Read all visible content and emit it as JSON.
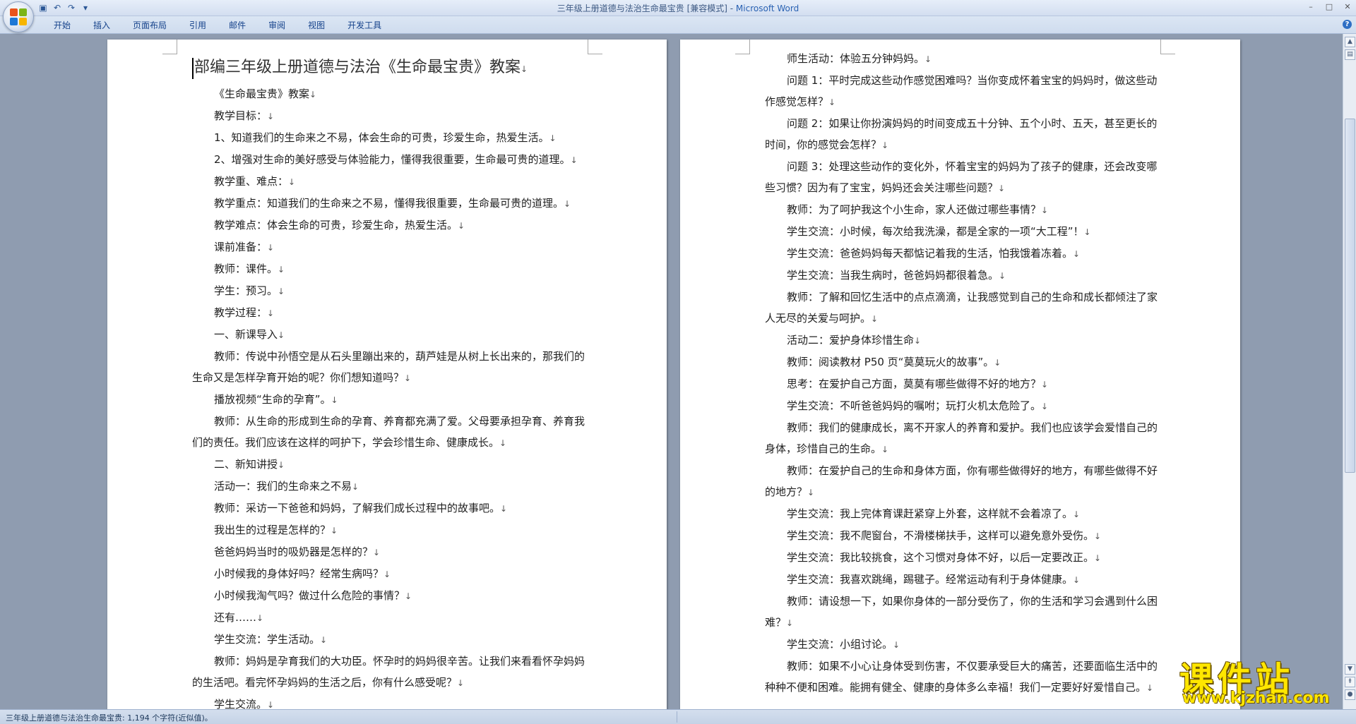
{
  "window": {
    "title": "三年级上册道德与法治生命最宝贵 [兼容模式] - ",
    "app_name": "Microsoft Word",
    "controls": [
      "–",
      "□",
      "✕"
    ]
  },
  "ribbon": {
    "tabs": [
      "开始",
      "插入",
      "页面布局",
      "引用",
      "邮件",
      "审阅",
      "视图",
      "开发工具"
    ]
  },
  "left_page": {
    "title": "部编三年级上册道德与法治《生命最宝贵》教案",
    "paragraphs": [
      "《生命最宝贵》教案",
      "教学目标：",
      "1、知道我们的生命来之不易，体会生命的可贵，珍爱生命，热爱生活。",
      "2、增强对生命的美好感受与体验能力，懂得我很重要，生命最可贵的道理。",
      "教学重、难点：",
      "教学重点：知道我们的生命来之不易，懂得我很重要，生命最可贵的道理。",
      "教学难点：体会生命的可贵，珍爱生命，热爱生活。",
      "课前准备：",
      "教师：课件。",
      "学生：预习。",
      "教学过程：",
      "一、新课导入",
      "教师：传说中孙悟空是从石头里蹦出来的，葫芦娃是从树上长出来的，那我们的生命又是怎样孕育开始的呢？你们想知道吗？",
      "播放视频“生命的孕育”。",
      "教师：从生命的形成到生命的孕育、养育都充满了爱。父母要承担孕育、养育我们的责任。我们应该在这样的呵护下，学会珍惜生命、健康成长。",
      "二、新知讲授",
      "活动一：我们的生命来之不易",
      "教师：采访一下爸爸和妈妈，了解我们成长过程中的故事吧。",
      "我出生的过程是怎样的？",
      "爸爸妈妈当时的吸奶器是怎样的？",
      "小时候我的身体好吗？经常生病吗？",
      "小时候我淘气吗？做过什么危险的事情？",
      "还有……",
      "学生交流：学生活动。",
      "教师：妈妈是孕育我们的大功臣。怀孕时的妈妈很辛苦。让我们来看看怀孕妈妈的生活吧。看完怀孕妈妈的生活之后，你有什么感受呢？",
      "学生交流。"
    ]
  },
  "right_page": {
    "paragraphs": [
      "师生活动：体验五分钟妈妈。",
      "问题 1：平时完成这些动作感觉困难吗？当你变成怀着宝宝的妈妈时，做这些动作感觉怎样？",
      "问题 2：如果让你扮演妈妈的时间变成五十分钟、五个小时、五天，甚至更长的时间，你的感觉会怎样？",
      "问题 3：处理这些动作的变化外，怀着宝宝的妈妈为了孩子的健康，还会改变哪些习惯？因为有了宝宝，妈妈还会关注哪些问题？",
      "教师：为了呵护我这个小生命，家人还做过哪些事情？",
      "学生交流：小时候，每次给我洗澡，都是全家的一项“大工程”！",
      "学生交流：爸爸妈妈每天都惦记着我的生活，怕我饿着冻着。",
      "学生交流：当我生病时，爸爸妈妈都很着急。",
      "教师：了解和回忆生活中的点点滴滴，让我感觉到自己的生命和成长都倾注了家人无尽的关爱与呵护。",
      "活动二：爱护身体珍惜生命",
      "教师：阅读教材 P50 页“莫莫玩火的故事”。",
      "思考：在爱护自己方面，莫莫有哪些做得不好的地方？",
      "学生交流：不听爸爸妈妈的嘱咐；玩打火机太危险了。",
      "教师：我们的健康成长，离不开家人的养育和爱护。我们也应该学会爱惜自己的身体，珍惜自己的生命。",
      "教师：在爱护自己的生命和身体方面，你有哪些做得好的地方，有哪些做得不好的地方？",
      "学生交流：我上完体育课赶紧穿上外套，这样就不会着凉了。",
      "学生交流：我不爬窗台，不滑楼梯扶手，这样可以避免意外受伤。",
      "学生交流：我比较挑食，这个习惯对身体不好，以后一定要改正。",
      "学生交流：我喜欢跳绳，踢毽子。经常运动有利于身体健康。",
      "教师：请设想一下，如果你身体的一部分受伤了，你的生活和学习会遇到什么困难？",
      "学生交流：小组讨论。",
      "教师：如果不小心让身体受到伤害，不仅要承受巨大的痛苦，还要面临生活中的种种不便和困难。能拥有健全、健康的身体多么幸福！我们一定要好好爱惜自己。"
    ]
  },
  "paragraph_mark": "↓",
  "status": {
    "text": "三年级上册道德与法治生命最宝贵: 1,194 个字符(近似值)。"
  },
  "watermark": {
    "main": "课件站",
    "url": "www.kjzhan.com"
  },
  "colors": {
    "ribbon_text": "#15428b",
    "watermark": "#ffe600"
  }
}
